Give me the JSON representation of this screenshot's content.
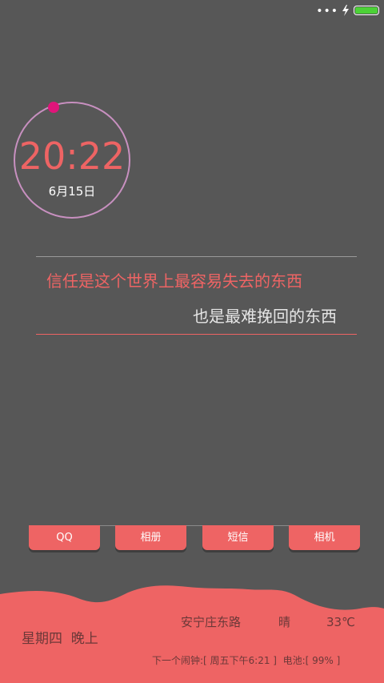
{
  "status_bar": {
    "dots_icon": "more-dots-icon",
    "bolt_icon": "charging-bolt-icon",
    "battery_icon": "battery-icon",
    "battery_level": 0.99,
    "battery_color": "#4cd137"
  },
  "clock": {
    "time": "20:22",
    "date": "6月15日",
    "ring_color": "#c890c0",
    "dot_color": "#e0157a"
  },
  "quote": {
    "line1": "信任是这个世界上最容易失去的东西",
    "line2": "也是最难挽回的东西"
  },
  "apps": [
    {
      "label": "QQ"
    },
    {
      "label": "相册"
    },
    {
      "label": "短信"
    },
    {
      "label": "相机"
    }
  ],
  "info": {
    "location": "安宁庄东路",
    "weather": "晴",
    "temperature": "33℃",
    "day": "星期四  晚上",
    "alarm_battery": "下一个闹钟:[ 周五下午6:21 ]  电池:[ 99% ]"
  },
  "colors": {
    "background": "#575757",
    "accent": "#ee6464"
  }
}
